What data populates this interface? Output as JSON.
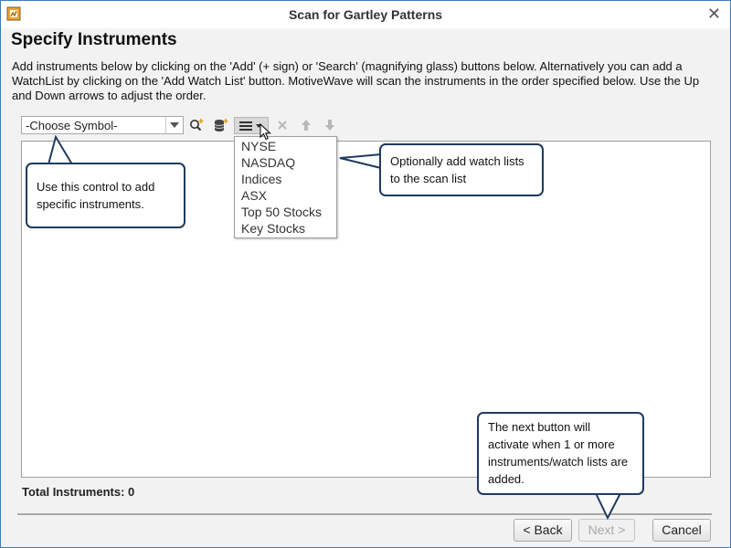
{
  "window": {
    "title": "Scan for Gartley Patterns"
  },
  "heading": "Specify Instruments",
  "description": "Add instruments below by clicking on the 'Add' (+ sign) or 'Search' (magnifying glass) buttons below. Alternatively you can add a WatchList by clicking on the 'Add Watch List' button.  MotiveWave will scan the instruments in the order specified below.  Use the Up and Down arrows to adjust the order.",
  "symbol_combo": {
    "value": "-Choose Symbol-"
  },
  "toolbar": {
    "icons": [
      "search-add-icon",
      "add-database-icon",
      "watchlist-menu-icon",
      "remove-icon",
      "move-up-icon",
      "move-down-icon"
    ]
  },
  "watchlist_menu": {
    "items": [
      "NYSE",
      "NASDAQ",
      "Indices",
      "ASX",
      "Top 50 Stocks",
      "Key Stocks"
    ]
  },
  "total_instruments": "Total Instruments: 0",
  "buttons": {
    "back": "< Back",
    "next": "Next >",
    "cancel": "Cancel"
  },
  "callouts": {
    "control": "Use this control to add specific instruments.",
    "watch": "Optionally add watch lists to the scan list",
    "next": "The next button will activate when 1 or more instruments/watch lists are added."
  },
  "colors": {
    "callout_border": "#1f3a60",
    "window_border": "#3b7bbf",
    "dialog_bg": "#f2f2f2"
  }
}
